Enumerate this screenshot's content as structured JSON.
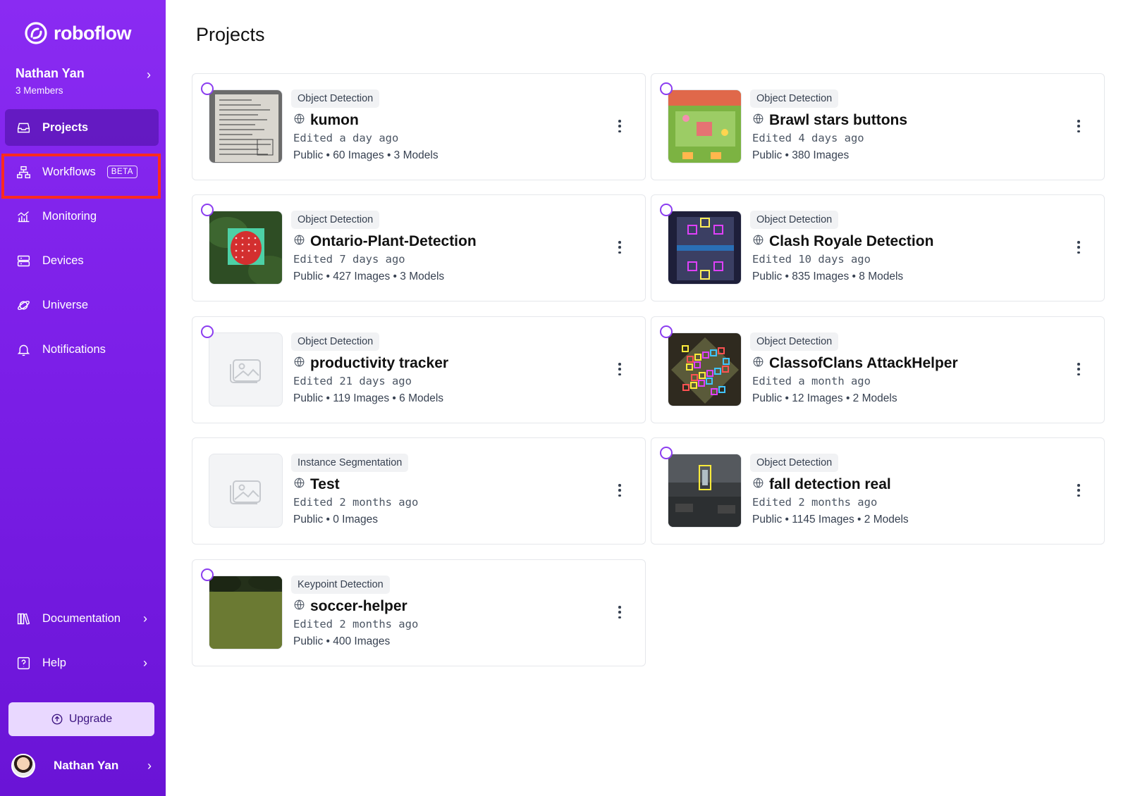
{
  "app": {
    "name": "roboflow",
    "workspace": {
      "name": "Nathan Yan",
      "members": "3 Members"
    },
    "page_title": "Projects"
  },
  "sidebar": {
    "items": [
      {
        "label": "Projects",
        "icon": "inbox-icon",
        "active": true
      },
      {
        "label": "Workflows",
        "icon": "workflow-icon",
        "badge": "BETA"
      },
      {
        "label": "Monitoring",
        "icon": "chart-icon"
      },
      {
        "label": "Devices",
        "icon": "server-icon"
      },
      {
        "label": "Universe",
        "icon": "planet-icon"
      },
      {
        "label": "Notifications",
        "icon": "bell-icon"
      }
    ],
    "bottom_items": [
      {
        "label": "Documentation",
        "icon": "books-icon"
      },
      {
        "label": "Help",
        "icon": "help-icon"
      }
    ],
    "upgrade_label": "Upgrade",
    "user_name": "Nathan Yan"
  },
  "colors": {
    "sidebar": "#7c1fe8",
    "highlight": "#ff2b1f",
    "ring": "#8b3df0"
  },
  "projects": [
    {
      "type": "Object Detection",
      "name": "kumon",
      "edited": "Edited a day ago",
      "meta": "Public • 60 Images • 3 Models",
      "thumb": "document"
    },
    {
      "type": "Object Detection",
      "name": "Brawl stars buttons",
      "edited": "Edited 4 days ago",
      "meta": "Public • 380 Images",
      "thumb": "game-green"
    },
    {
      "type": "Object Detection",
      "name": "Ontario-Plant-Detection",
      "edited": "Edited 7 days ago",
      "meta": "Public • 427 Images • 3 Models",
      "thumb": "strawberry"
    },
    {
      "type": "Object Detection",
      "name": "Clash Royale Detection",
      "edited": "Edited 10 days ago",
      "meta": "Public • 835 Images • 8 Models",
      "thumb": "arena"
    },
    {
      "type": "Object Detection",
      "name": "productivity tracker",
      "edited": "Edited 21 days ago",
      "meta": "Public • 119 Images • 6 Models",
      "thumb": "placeholder"
    },
    {
      "type": "Object Detection",
      "name": "ClassofClans AttackHelper",
      "edited": "Edited a month ago",
      "meta": "Public • 12 Images • 2 Models",
      "thumb": "village"
    },
    {
      "type": "Instance Segmentation",
      "name": "Test",
      "edited": "Edited 2 months ago",
      "meta": "Public • 0 Images",
      "thumb": "placeholder"
    },
    {
      "type": "Object Detection",
      "name": "fall detection real",
      "edited": "Edited 2 months ago",
      "meta": "Public • 1145 Images • 2 Models",
      "thumb": "room"
    },
    {
      "type": "Keypoint Detection",
      "name": "soccer-helper",
      "edited": "Edited 2 months ago",
      "meta": "Public • 400 Images",
      "thumb": "field"
    }
  ]
}
